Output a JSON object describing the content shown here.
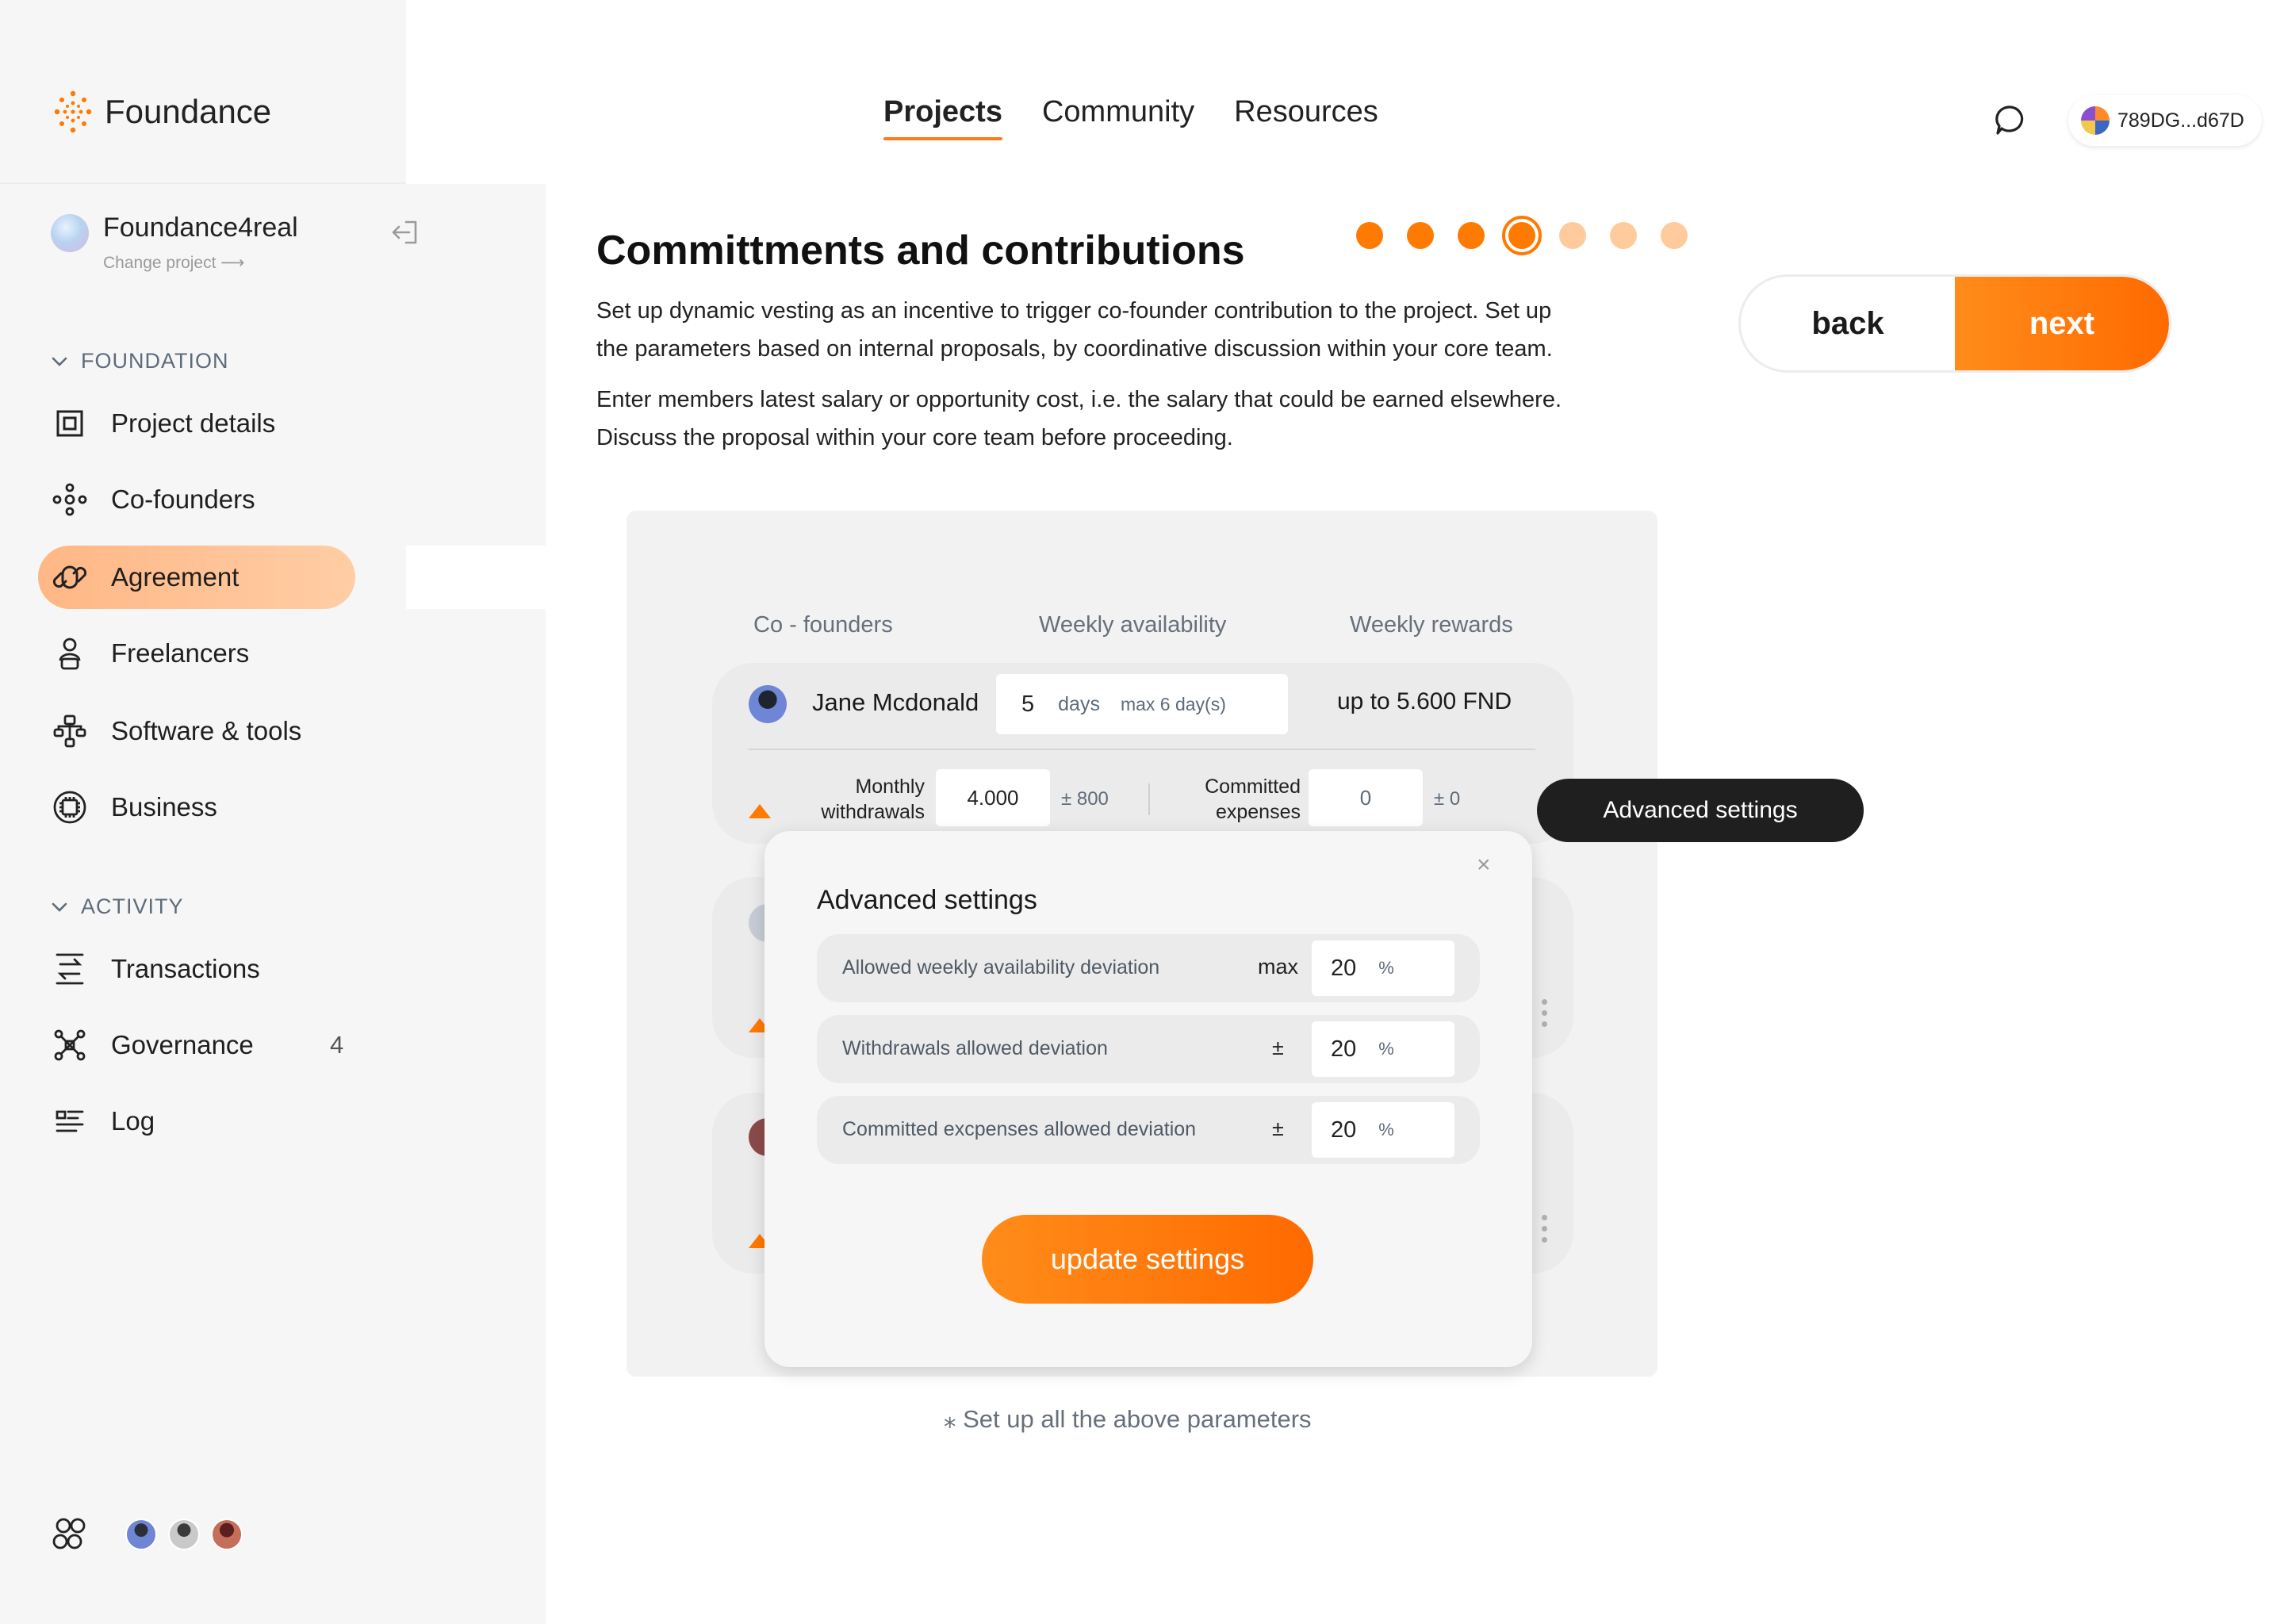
{
  "app": {
    "name": "Foundance",
    "accent": "#ff7a00"
  },
  "project": {
    "name": "Foundance4real",
    "change_label": "Change project ⟶"
  },
  "sidebar": {
    "sections": [
      {
        "label": "FOUNDATION",
        "items": [
          {
            "label": "Project details",
            "icon": "square-frame-icon"
          },
          {
            "label": "Co-founders",
            "icon": "co-founders-icon"
          },
          {
            "label": "Agreement",
            "icon": "agreement-icon",
            "active": true
          },
          {
            "label": "Freelancers",
            "icon": "freelancer-icon"
          },
          {
            "label": "Software & tools",
            "icon": "hierarchy-icon"
          },
          {
            "label": "Business",
            "icon": "chip-icon"
          }
        ]
      },
      {
        "label": "ACTIVITY",
        "items": [
          {
            "label": "Transactions",
            "icon": "transactions-icon"
          },
          {
            "label": "Governance",
            "icon": "governance-icon",
            "badge": "4"
          },
          {
            "label": "Log",
            "icon": "log-icon"
          }
        ]
      }
    ]
  },
  "topnav": {
    "items": [
      "Projects",
      "Community",
      "Resources"
    ],
    "active": "Projects"
  },
  "wallet": {
    "address": "789DG...d67D"
  },
  "page": {
    "title": "Committments and contributions",
    "steps": {
      "total": 7,
      "completed": 3,
      "current": 4
    },
    "paragraph1_line1": "Set up dynamic vesting as an incentive to trigger co-founder contribution to the project. Set up",
    "paragraph1_line2": "the parameters based on internal proposals, by coordinative discussion within your core team.",
    "paragraph2_line1": "Enter members latest salary or opportunity cost, i.e. the salary that could be earned elsewhere.",
    "paragraph2_line2": "Discuss the proposal within your core team before proceeding.",
    "back_label": "back",
    "next_label": "next"
  },
  "table": {
    "headers": [
      "Co - founders",
      "Weekly availability",
      "Weekly rewards"
    ],
    "row1": {
      "name": "Jane Mcdonald",
      "days": "5",
      "days_unit": "days",
      "days_max": "max 6 day(s)",
      "rewards": "up to 5.600  FND",
      "withdrawals_label_1": "Monthly",
      "withdrawals_label_2": "withdrawals",
      "withdrawals_value": "4.000",
      "withdrawals_dev": "± 800",
      "committed_label_1": "Committed",
      "committed_label_2": "expenses",
      "committed_value": "0",
      "committed_dev": "± 0"
    }
  },
  "advanced_pill": "Advanced settings",
  "modal": {
    "title": "Advanced settings",
    "close": "×",
    "rows": [
      {
        "label": "Allowed weekly availability deviation",
        "qualifier": "max",
        "value": "20",
        "unit": "%"
      },
      {
        "label": "Withdrawals allowed deviation",
        "qualifier": "±",
        "value": "20",
        "unit": "%"
      },
      {
        "label": "Committed excpenses allowed deviation",
        "qualifier": "±",
        "value": "20",
        "unit": "%"
      }
    ],
    "button": "update settings"
  },
  "footnote": "⁎  Set up all the above parameters"
}
